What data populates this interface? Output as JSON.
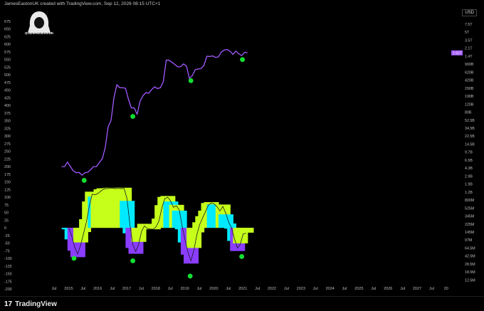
{
  "header": {
    "credit": "JamesEastonUK created with TradingView.com, Sep 12, 2026 08:15 UTC+1",
    "handle": "@JamesEastonUK",
    "currency": "USD"
  },
  "footer": {
    "logo_mark": "17",
    "brand": "TradingView"
  },
  "colors": {
    "price_line": "#a259ff",
    "hist_bull": "#c6ff1a",
    "hist_bear": "#00eaff",
    "hist_deep": "#8b3dff",
    "signal": "#ffffff",
    "marker": "#12e030"
  },
  "chart_data": [
    {
      "type": "line",
      "y_axis_left_ticks": [
        "675",
        "650",
        "625",
        "600",
        "575",
        "550",
        "525",
        "500",
        "475",
        "450",
        "425",
        "400",
        "375",
        "350",
        "325",
        "300",
        "275",
        "250",
        "225",
        "200",
        "175",
        "150",
        "125",
        "100",
        "75",
        "50",
        "25",
        "0",
        "-25",
        "-50",
        "-75",
        "-100",
        "-125",
        "-150",
        "-175",
        "-200"
      ],
      "y_axis_right_ticks": [
        "7.5T",
        "5T",
        "3.5T",
        "2.1T",
        "1.4T",
        "900B",
        "620B",
        "420B",
        "290B",
        "190B",
        "120B",
        "80B",
        "52.5B",
        "34.5B",
        "22.5B",
        "14.5B",
        "9.7B",
        "6.5B",
        "4.3B",
        "2.9B",
        "1.9B",
        "1.2B",
        "800M",
        "525M",
        "345M",
        "225M",
        "145M",
        "97M",
        "64.5M",
        "42.5M",
        "28.5M",
        "18.5M",
        "12.5M"
      ],
      "x_axis_labels": [
        "Jul",
        "2015",
        "Jul",
        "2016",
        "Jul",
        "2017",
        "Jul",
        "2018",
        "Jul",
        "2019",
        "Jul",
        "2020",
        "Jul",
        "2021",
        "Jul",
        "2022",
        "Jul",
        "2023",
        "Jul",
        "2024",
        "Jul",
        "2025",
        "Jul",
        "2026",
        "Jul",
        "2027",
        "Jul",
        "20"
      ],
      "last_value_label": "2.92T",
      "series": [
        {
          "x": [
            2014.1,
            2014.3,
            2014.5,
            2014.7,
            2014.9,
            2015.1,
            2015.3,
            2015.5,
            2015.7,
            2015.9,
            2016.1,
            2016.3,
            2016.5,
            2016.7,
            2016.9,
            2017.1,
            2017.3,
            2017.5,
            2017.7,
            2017.9,
            2018.1,
            2018.3,
            2018.5,
            2018.7,
            2018.9,
            2019.1,
            2019.3,
            2019.5,
            2019.7,
            2019.9,
            2020.1,
            2020.3,
            2020.5,
            2020.7,
            2020.9,
            2021.1,
            2021.3,
            2021.5,
            2021.7,
            2021.9,
            2022.1,
            2022.3,
            2022.5,
            2022.7,
            2022.9,
            2023.1,
            2023.3,
            2023.5,
            2023.7,
            2023.9,
            2024.1,
            2024.3,
            2024.5,
            2024.7,
            2024.9,
            2025.1,
            2025.3,
            2025.5,
            2025.7,
            2025.9,
            2026.1,
            2026.3,
            2026.5,
            2026.7,
            2026.9
          ],
          "values": [
            200,
            200,
            215,
            200,
            186,
            180,
            181,
            172,
            180,
            182,
            190,
            200,
            200,
            214,
            226,
            262,
            330,
            351,
            425,
            468,
            458,
            458,
            456,
            420,
            392,
            392,
            371,
            414,
            432,
            442,
            440,
            452,
            461,
            455,
            458,
            478,
            548,
            548,
            541,
            534,
            526,
            527,
            536,
            528,
            488,
            498,
            517,
            519,
            521,
            531,
            561,
            560,
            562,
            557,
            559,
            575,
            581,
            583,
            577,
            567,
            578,
            569,
            563,
            574,
            572
          ]
        }
      ],
      "markers": [
        {
          "x": 2015.65,
          "y": 155
        },
        {
          "x": 2019.0,
          "y": 364
        },
        {
          "x": 2023.0,
          "y": 481
        },
        {
          "x": 2026.55,
          "y": 550
        }
      ]
    },
    {
      "type": "area",
      "x": [
        2014.6,
        2014.8,
        2015.0,
        2015.2,
        2015.4,
        2015.6,
        2015.8,
        2016.0,
        2016.2,
        2016.4,
        2016.6,
        2016.8,
        2017.0,
        2017.2,
        2017.4,
        2017.6,
        2017.8,
        2018.0,
        2018.2,
        2018.4,
        2018.6,
        2018.8,
        2019.0,
        2019.2,
        2019.4,
        2019.6,
        2019.8,
        2020.0,
        2020.2,
        2020.4,
        2020.6,
        2020.8,
        2021.0,
        2021.2,
        2021.4,
        2021.6,
        2021.8,
        2022.0,
        2022.2,
        2022.4,
        2022.6,
        2022.8,
        2023.0,
        2023.2,
        2023.4,
        2023.6,
        2023.8,
        2024.0,
        2024.2,
        2024.4,
        2024.6,
        2024.8,
        2025.0,
        2025.2,
        2025.4,
        2025.6,
        2025.8,
        2026.0,
        2026.2,
        2026.4,
        2026.6,
        2026.8
      ],
      "values": [
        -5,
        -38,
        -75,
        -96,
        -48,
        -14,
        28,
        86,
        118,
        102,
        115,
        126,
        129,
        129,
        130,
        131,
        128,
        130,
        129,
        131,
        88,
        -18,
        -66,
        -85,
        -46,
        -2,
        13,
        -2,
        -4,
        -5,
        6,
        30,
        74,
        101,
        104,
        86,
        64,
        75,
        56,
        -5,
        -48,
        -88,
        -117,
        -66,
        -15,
        18,
        38,
        56,
        81,
        84,
        76,
        67,
        50,
        76,
        44,
        14,
        -3,
        -43,
        -76,
        -51,
        -11,
        -16
      ],
      "signal": [
        -2,
        -28,
        -64,
        -86,
        -58,
        -20,
        18,
        70,
        110,
        108,
        112,
        120,
        127,
        128,
        129,
        130,
        128,
        129,
        128,
        129,
        95,
        10,
        -55,
        -78,
        -55,
        -12,
        6,
        -2,
        -4,
        -5,
        3,
        22,
        65,
        95,
        100,
        88,
        67,
        72,
        58,
        5,
        -40,
        -80,
        -108,
        -75,
        -25,
        10,
        32,
        52,
        74,
        81,
        78,
        69,
        55,
        70,
        48,
        18,
        0,
        -36,
        -66,
        -54,
        -20,
        -18
      ],
      "markers": [
        {
          "x": 2014.95,
          "y": -100
        },
        {
          "x": 2019.0,
          "y": -108
        },
        {
          "x": 2022.95,
          "y": -158
        },
        {
          "x": 2026.5,
          "y": -94
        }
      ]
    }
  ]
}
